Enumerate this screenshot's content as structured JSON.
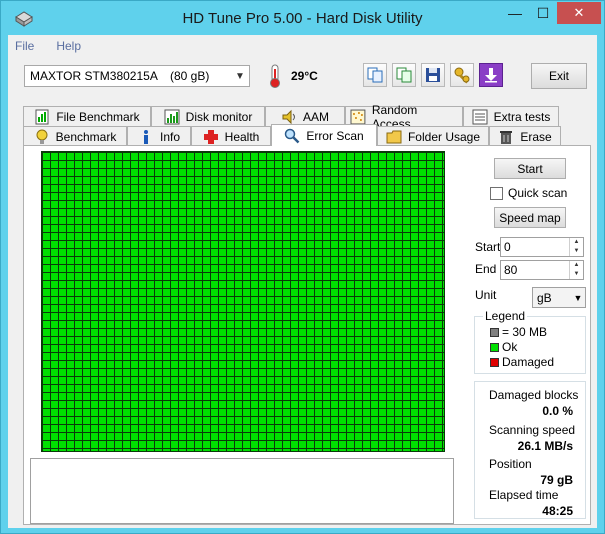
{
  "window": {
    "title": "HD Tune Pro 5.00 - Hard Disk Utility",
    "minimize": "—",
    "maximize": "☐",
    "close": "✕"
  },
  "menu": {
    "file": "File",
    "help": "Help"
  },
  "toolbar": {
    "drive": "MAXTOR STM380215A",
    "capacity": "(80 gB)",
    "temperature": "29°C",
    "exit_label": "Exit"
  },
  "tabs": {
    "row1": [
      "File Benchmark",
      "Disk monitor",
      "AAM",
      "Random Access",
      "Extra tests"
    ],
    "row2": [
      "Benchmark",
      "Info",
      "Health",
      "Error Scan",
      "Folder Usage",
      "Erase"
    ],
    "active": "Error Scan"
  },
  "error_scan": {
    "start_label": "Start",
    "quick_scan_label": "Quick scan",
    "quick_scan_checked": false,
    "speed_map_label": "Speed map",
    "start_field_label": "Start",
    "start_value": "0",
    "end_field_label": "End",
    "end_value": "80",
    "unit_label": "Unit",
    "unit_value": "gB",
    "legend": {
      "title": "Legend",
      "block_size": "= 30 MB",
      "ok": "Ok",
      "damaged": "Damaged"
    },
    "stats": {
      "damaged_blocks_label": "Damaged blocks",
      "damaged_blocks_value": "0.0 %",
      "scanning_speed_label": "Scanning speed",
      "scanning_speed_value": "26.1 MB/s",
      "position_label": "Position",
      "position_value": "79 gB",
      "elapsed_label": "Elapsed time",
      "elapsed_value": "48:25"
    }
  },
  "colors": {
    "ok": "#00e000",
    "damaged": "#e00000",
    "block": "#808080",
    "titlebar": "#5fd1ec"
  }
}
